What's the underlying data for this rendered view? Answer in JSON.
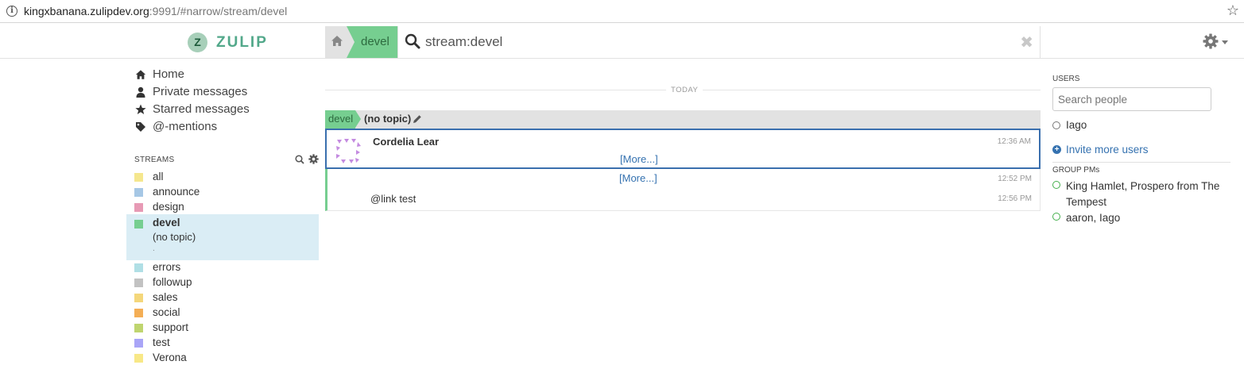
{
  "browser": {
    "url_host": "kingxbanana.zulipdev.org",
    "url_rest": ":9991/#narrow/stream/devel"
  },
  "header": {
    "logo_letter": "Z",
    "logo_text": "ZULIP",
    "narrow_stream": "devel",
    "search_query": "stream:devel",
    "close_glyph": "✖"
  },
  "left_nav": {
    "items": [
      {
        "label": "Home",
        "icon": "home-icon"
      },
      {
        "label": "Private messages",
        "icon": "user-icon"
      },
      {
        "label": "Starred messages",
        "icon": "star-icon"
      },
      {
        "label": "@-mentions",
        "icon": "tag-icon"
      }
    ],
    "streams_title": "STREAMS",
    "streams": [
      {
        "name": "all",
        "color": "#f5e78e"
      },
      {
        "name": "announce",
        "color": "#a6c7e5"
      },
      {
        "name": "design",
        "color": "#e79ab5"
      },
      {
        "name": "devel",
        "color": "#76ce90"
      },
      {
        "name": "errors",
        "color": "#b0dfe5"
      },
      {
        "name": "followup",
        "color": "#c2c2c2"
      },
      {
        "name": "sales",
        "color": "#f4d77b"
      },
      {
        "name": "social",
        "color": "#f4ae55"
      },
      {
        "name": "support",
        "color": "#bfd56f"
      },
      {
        "name": "test",
        "color": "#a9a5f7"
      },
      {
        "name": "Verona",
        "color": "#f8e887"
      }
    ],
    "active_topic": "(no topic)",
    "active_dot": "."
  },
  "messages": {
    "date_label": "TODAY",
    "recipient_stream": "devel",
    "recipient_topic": "(no topic)",
    "items": [
      {
        "sender": "Cordelia Lear",
        "time": "12:36 AM",
        "content": "[More...]"
      },
      {
        "time": "12:52 PM",
        "content": "[More...]"
      },
      {
        "time": "12:56 PM",
        "content": "@link test"
      }
    ]
  },
  "right_sidebar": {
    "users_title": "USERS",
    "search_placeholder": "Search people",
    "users": [
      {
        "name": "Iago"
      }
    ],
    "invite_label": "Invite more users",
    "group_title": "GROUP PMs",
    "group_pms": [
      {
        "name": "King Hamlet, Prospero from The Tempest"
      },
      {
        "name": "aaron, Iago"
      }
    ]
  },
  "colors": {
    "accent": "#76ce90",
    "link": "#3572b0",
    "selected_border": "#3a6fae",
    "active_row": "#daedf5"
  }
}
